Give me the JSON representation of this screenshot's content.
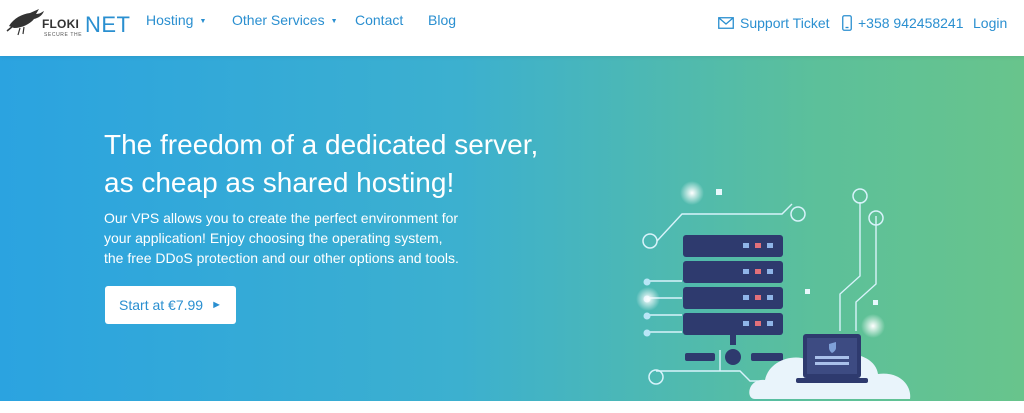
{
  "brand": {
    "name_part1": "FLOKI",
    "name_part2": "NET",
    "tagline": "SECURE THE"
  },
  "nav": {
    "items": [
      {
        "label": "Hosting",
        "has_dropdown": true
      },
      {
        "label": "Other Services",
        "has_dropdown": true
      },
      {
        "label": "Contact",
        "has_dropdown": false
      },
      {
        "label": "Blog",
        "has_dropdown": false
      }
    ],
    "caret": "▼"
  },
  "header_right": {
    "support_label": "Support Ticket",
    "support_icon": "envelope-icon",
    "phone_label": "+358 942458241",
    "phone_icon": "phone-icon",
    "login_label": "Login"
  },
  "hero": {
    "title_line1": "The freedom of a dedicated server,",
    "title_line2": "as cheap as shared hosting!",
    "desc_line1": "Our VPS allows you to create the perfect environment for",
    "desc_line2": "your application! Enjoy choosing the operating system,",
    "desc_line3": "the free DDoS protection and our other options and tools.",
    "cta_label": "Start at €7.99",
    "cta_arrow": "►"
  },
  "colors": {
    "accent": "#2a8fd0",
    "hero_start": "#2ba3e0",
    "hero_end": "#68c48c",
    "server_dark": "#2e3a6e",
    "cloud": "#e9f4fb"
  }
}
